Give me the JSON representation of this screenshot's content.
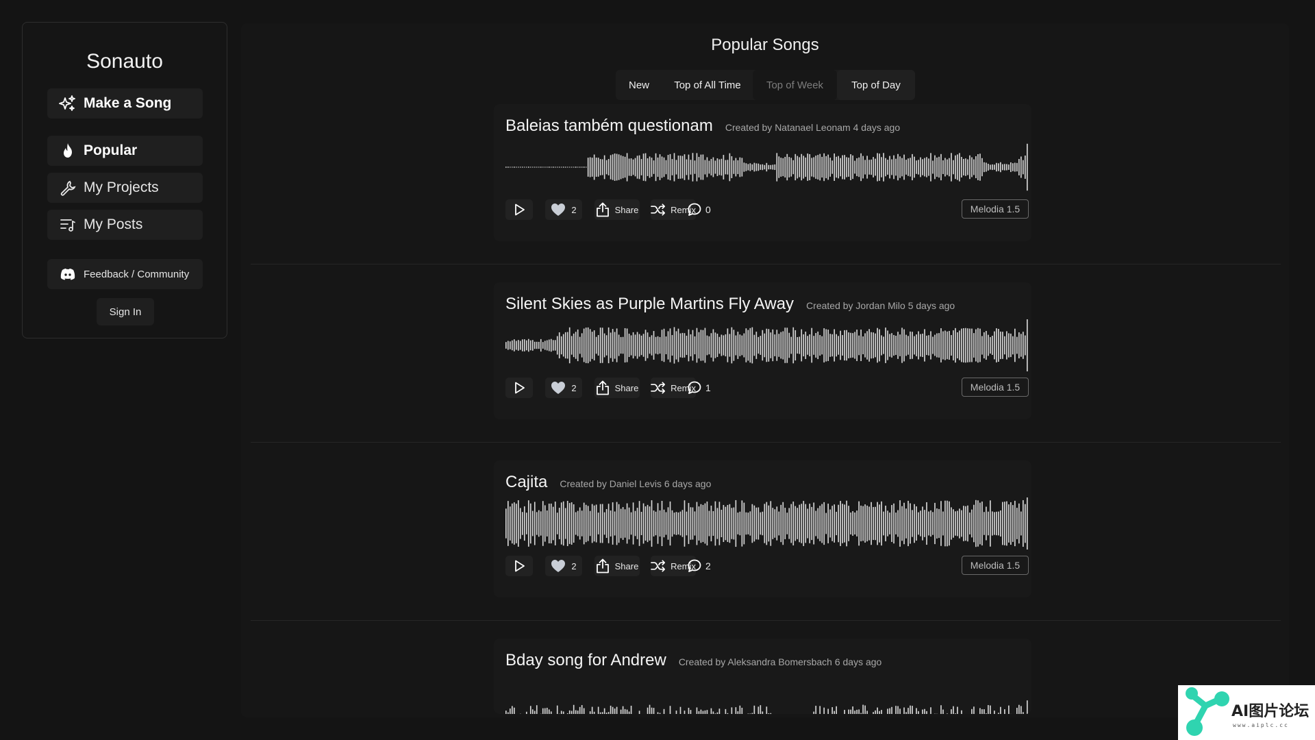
{
  "sidebar": {
    "brand": "Sonauto",
    "make_song": "Make a Song",
    "popular": "Popular",
    "my_projects": "My Projects",
    "my_posts": "My Posts",
    "feedback": "Feedback / Community",
    "sign_in": "Sign In"
  },
  "main": {
    "title": "Popular Songs",
    "tabs": [
      {
        "label": "New"
      },
      {
        "label": "Top of All Time"
      },
      {
        "label": "Top of Week"
      },
      {
        "label": "Top of Day"
      }
    ]
  },
  "actions": {
    "share_label": "Share",
    "remix_label": "Remix"
  },
  "songs": [
    {
      "title": "Baleias também questionam",
      "meta": "Created by Natanael Leonam 4 days ago",
      "likes": "2",
      "comments": "0",
      "model": "Melodia 1.5"
    },
    {
      "title": "Silent Skies as Purple Martins Fly Away",
      "meta": "Created by Jordan Milo 5 days ago",
      "likes": "2",
      "comments": "1",
      "model": "Melodia 1.5"
    },
    {
      "title": "Cajita",
      "meta": "Created by Daniel Levis 6 days ago",
      "likes": "2",
      "comments": "2",
      "model": "Melodia 1.5"
    },
    {
      "title": "Bday song for Andrew",
      "meta": "Created by Aleksandra Bomersbach 6 days ago"
    }
  ],
  "watermark": {
    "text": "AI图片论坛",
    "sub": "www.aiplc.cc"
  },
  "colors": {
    "background": "#141414",
    "panel": "#161616",
    "card": "#191919",
    "waveform": "#d9d9d9",
    "watermark_accent": "#2fd4b0"
  }
}
